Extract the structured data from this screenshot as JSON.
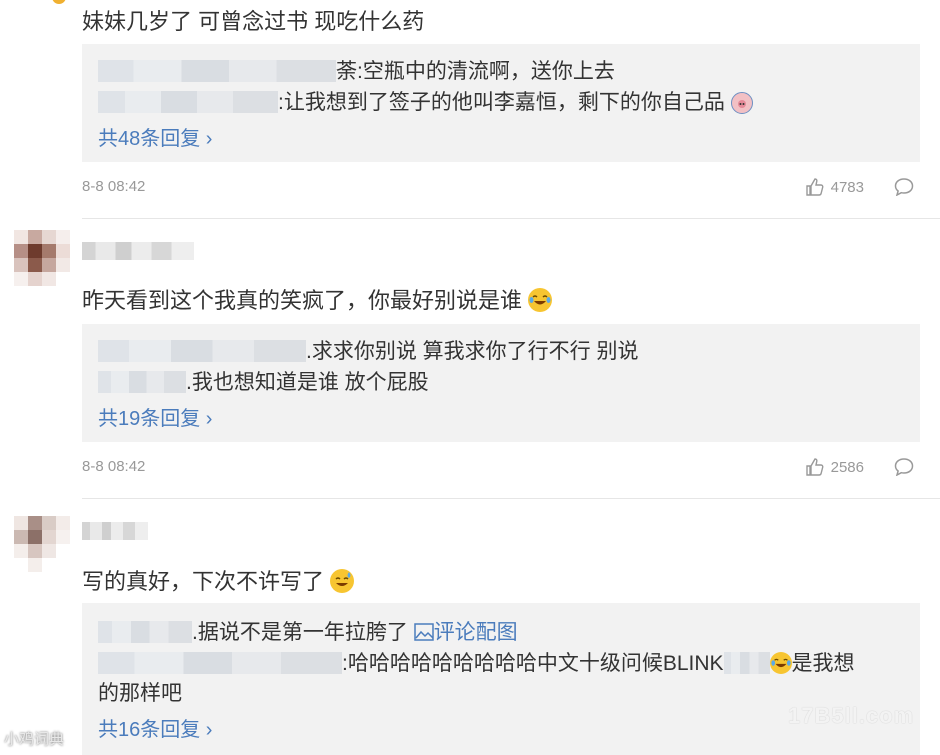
{
  "comments": [
    {
      "text": "妹妹几岁了 可曾念过书 现吃什么药",
      "replies": [
        {
          "suffix": "荼:空瓶中的清流啊，送你上去"
        },
        {
          "suffix": ":让我想到了签子的他叫李嘉恒，剩下的你自己品"
        }
      ],
      "more": "共48条回复",
      "time": "8-8 08:42",
      "likes": "4783"
    },
    {
      "text": "昨天看到这个我真的笑疯了，你最好别说是谁",
      "replies": [
        {
          "suffix": ".求求你别说 算我求你了行不行 别说"
        },
        {
          "suffix": ".我也想知道是谁 放个屁股"
        }
      ],
      "more": "共19条回复",
      "time": "8-8 08:42",
      "likes": "2586"
    },
    {
      "text": "写的真好，下次不许写了",
      "replies": [
        {
          "suffix": ".据说不是第一年拉胯了",
          "link": "评论配图"
        },
        {
          "suffix": ":哈哈哈哈哈哈哈哈哈中文十级问候BLINK",
          "tail": "是我想",
          "wrap": "的那样吧"
        }
      ],
      "more": "共16条回复"
    }
  ],
  "watermarks": {
    "left": "小鸡词典",
    "right": "17B5ll.com"
  },
  "colors": {
    "link": "#4b7cbc",
    "reply_bg": "#f2f2f2",
    "meta": "#999999"
  },
  "icons": [
    "thumb-up-icon",
    "comment-bubble-icon",
    "image-icon",
    "laugh-cry-emoji",
    "sweat-smile-emoji",
    "pig-emoji"
  ]
}
